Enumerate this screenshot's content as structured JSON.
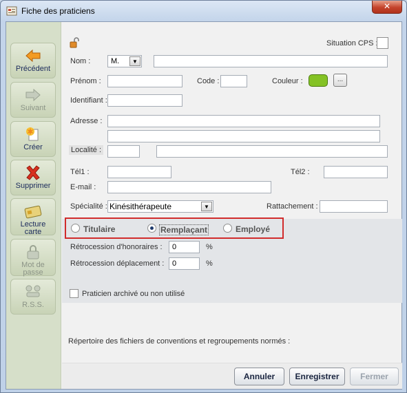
{
  "window": {
    "title": "Fiche des praticiens",
    "close_label": "✕"
  },
  "sidebar": {
    "items": [
      {
        "label": "Précédent",
        "icon": "arrow-left-icon",
        "enabled": true
      },
      {
        "label": "Suivant",
        "icon": "arrow-right-icon",
        "enabled": false
      },
      {
        "label": "Créer",
        "icon": "create-icon",
        "enabled": true
      },
      {
        "label": "Supprimer",
        "icon": "delete-icon",
        "enabled": true
      },
      {
        "label": "Lecture carte",
        "label_line1": "Lecture",
        "label_line2": "carte",
        "icon": "card-reader-icon",
        "enabled": true
      },
      {
        "label": "Mot de passe",
        "label_line1": "Mot de",
        "label_line2": "passe",
        "icon": "password-icon",
        "enabled": false
      },
      {
        "label": "R.S.S.",
        "icon": "rss-icon",
        "enabled": false
      }
    ]
  },
  "form": {
    "situation_cps_label": "Situation CPS :",
    "nom_label": "Nom :",
    "civilite_value": "M.",
    "nom_value": "",
    "prenom_label": "Prénom :",
    "prenom_value": "",
    "code_label": "Code :",
    "code_value": "",
    "couleur_label": "Couleur :",
    "couleur_color": "#84c225",
    "couleur_button_label": "...",
    "identifiant_label": "Identifiant :",
    "identifiant_value": "",
    "adresse_label": "Adresse :",
    "adresse_line1": "",
    "adresse_line2": "",
    "localite_label": "Localité :",
    "localite_cp": "",
    "localite_ville": "",
    "tel1_label": "Tél1 :",
    "tel1_value": "",
    "tel2_label": "Tél2 :",
    "tel2_value": "",
    "email_label": "E-mail :",
    "email_value": "",
    "specialite_label": "Spécialité :",
    "specialite_value": "Kinésithérapeute",
    "rattachement_label": "Rattachement :",
    "rattachement_value": "",
    "status_options": [
      {
        "label": "Titulaire",
        "checked": false
      },
      {
        "label": "Remplaçant",
        "checked": true
      },
      {
        "label": "Employé",
        "checked": false
      }
    ],
    "retro_honoraires_label": "Rétrocession d'honoraires :",
    "retro_honoraires_value": "0",
    "retro_deplacement_label": "Rétrocession déplacement :",
    "retro_deplacement_value": "0",
    "percent_unit": "%",
    "archive_label": "Praticien archivé ou non utilisé",
    "archive_checked": false,
    "repertoire_label": "Répertoire des fichiers de conventions et regroupements normés :"
  },
  "footer": {
    "annuler_label": "Annuler",
    "enregistrer_label": "Enregistrer",
    "fermer_label": "Fermer"
  },
  "colors": {
    "highlight": "#d12b2b",
    "sidebar_bg": "#d6dfc9"
  }
}
